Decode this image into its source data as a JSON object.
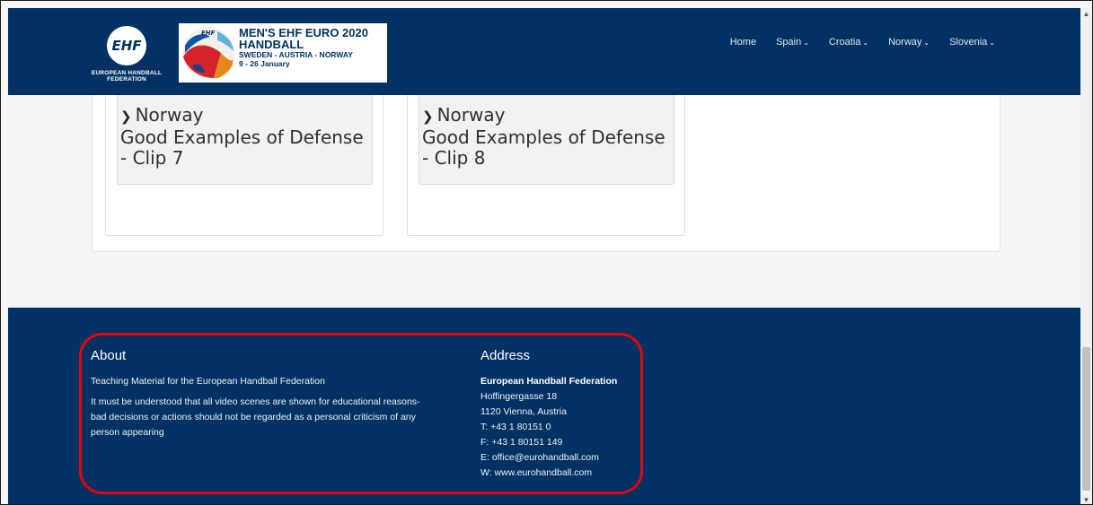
{
  "header": {
    "ehf_logo_text": "EHF",
    "ehf_caption_line1": "EUROPEAN HANDBALL",
    "ehf_caption_line2": "FEDERATION",
    "banner": {
      "ball_text": "EHF",
      "line1": "MEN'S EHF EURO 2020",
      "line2": "HANDBALL",
      "line3": "SWEDEN - AUSTRIA - NORWAY",
      "line4": "9 - 26 January"
    },
    "nav": [
      {
        "label": "Home",
        "dropdown": false
      },
      {
        "label": "Spain",
        "dropdown": true
      },
      {
        "label": "Croatia",
        "dropdown": true
      },
      {
        "label": "Norway",
        "dropdown": true
      },
      {
        "label": "Slovenia",
        "dropdown": true
      }
    ]
  },
  "cards": [
    {
      "country": "Norway",
      "title_line1": "Good Examples of Defense",
      "title_line2": "- Clip 7"
    },
    {
      "country": "Norway",
      "title_line1": "Good Examples of Defense",
      "title_line2": "- Clip 8"
    }
  ],
  "footer": {
    "about": {
      "heading": "About",
      "p1": "Teaching Material for the European Handball Federation",
      "p2_line1": "It must be understood that all video scenes are shown for educational reasons-",
      "p2_line2": "bad decisions or actions should not be regarded as a personal criticism of any",
      "p2_line3": "person appearing"
    },
    "address": {
      "heading": "Address",
      "org": "European Handball Federation",
      "street": "Hoffingergasse 18",
      "city": "1120 Vienna, Austria",
      "phone": "T: +43 1 80151 0",
      "fax": "F: +43 1 80151 149",
      "email": "E: office@eurohandball.com",
      "web": "W: www.eurohandball.com"
    },
    "highlight_color": "#e3050d"
  },
  "colors": {
    "brand_navy": "#023263",
    "page_bg": "#f5f5f5"
  },
  "icons": {
    "chevron": "chevron-down-icon",
    "scroll_up": "scroll-up-arrow-icon",
    "scroll_down": "scroll-down-arrow-icon"
  }
}
